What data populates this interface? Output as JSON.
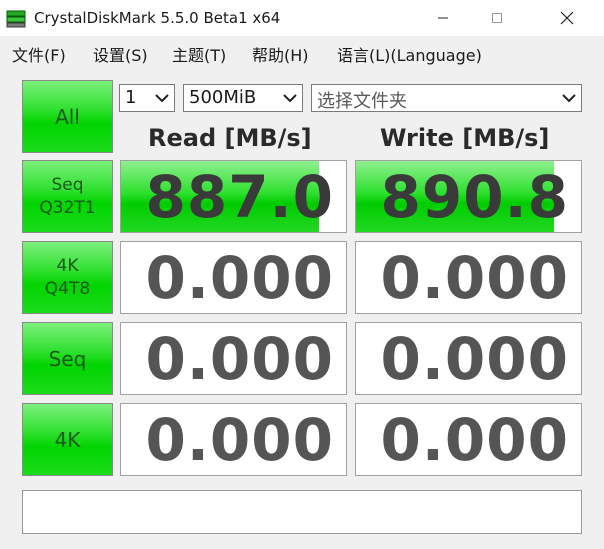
{
  "window": {
    "title": "CrystalDiskMark 5.5.0 Beta1 x64"
  },
  "menu": {
    "items": [
      "文件(F)",
      "设置(S)",
      "主题(T)",
      "帮助(H)",
      "语言(L)(Language)"
    ]
  },
  "controls": {
    "all_label": "All",
    "count_value": "1",
    "size_value": "500MiB",
    "drive_placeholder": "选择文件夹"
  },
  "columns": {
    "read": "Read [MB/s]",
    "write": "Write [MB/s]"
  },
  "tests": [
    {
      "label": "Seq\nQ32T1",
      "read": "887.0",
      "write": "890.8",
      "read_fill": 0.88,
      "write_fill": 0.88
    },
    {
      "label": "4K\nQ4T8",
      "read": "0.000",
      "write": "0.000",
      "read_fill": 0,
      "write_fill": 0
    },
    {
      "label": "Seq",
      "read": "0.000",
      "write": "0.000",
      "read_fill": 0,
      "write_fill": 0
    },
    {
      "label": "4K",
      "read": "0.000",
      "write": "0.000",
      "read_fill": 0,
      "write_fill": 0
    }
  ],
  "status": {
    "text": ""
  },
  "colors": {
    "bar_green": "#00cc00",
    "button_green": "#2fe02f",
    "value_text": "#3a3a3a"
  }
}
